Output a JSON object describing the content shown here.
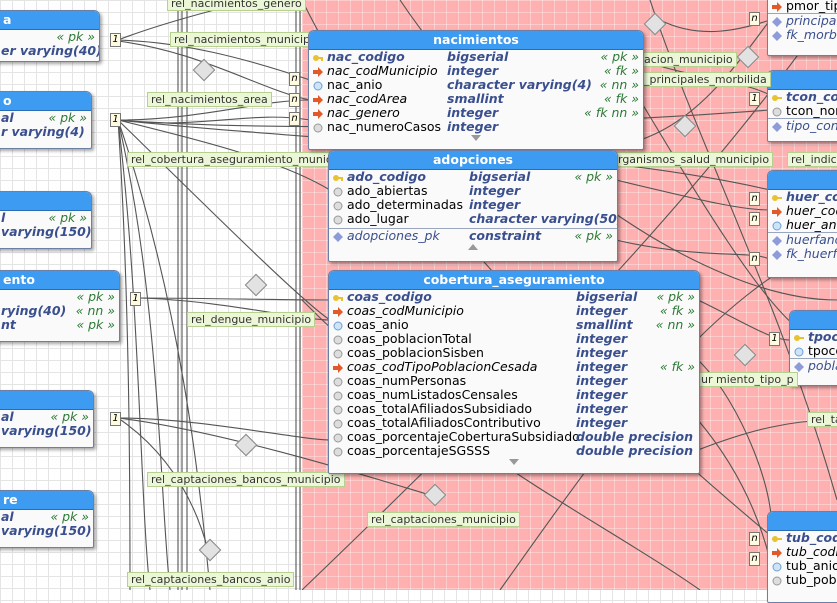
{
  "tables": {
    "nacimientos": {
      "title": "nacimientos",
      "columns": [
        {
          "name": "nac_codigo",
          "type": "bigserial",
          "constraint": "« pk »",
          "kind": "pk"
        },
        {
          "name": "nac_codMunicipio",
          "type": "integer",
          "constraint": "« fk »",
          "kind": "fk"
        },
        {
          "name": "nac_anio",
          "type": "character varying(4)",
          "constraint": "« nn »",
          "kind": "nn"
        },
        {
          "name": "nac_codArea",
          "type": "smallint",
          "constraint": "« fk »",
          "kind": "fk"
        },
        {
          "name": "nac_genero",
          "type": "integer",
          "constraint": "« fk nn »",
          "kind": "fk"
        },
        {
          "name": "nac_numeroCasos",
          "type": "integer",
          "constraint": "",
          "kind": "col"
        }
      ]
    },
    "adopciones": {
      "title": "adopciones",
      "columns": [
        {
          "name": "ado_codigo",
          "type": "bigserial",
          "constraint": "« pk »",
          "kind": "pk"
        },
        {
          "name": "ado_abiertas",
          "type": "integer",
          "constraint": "",
          "kind": "col"
        },
        {
          "name": "ado_determinadas",
          "type": "integer",
          "constraint": "",
          "kind": "col"
        },
        {
          "name": "ado_lugar",
          "type": "character varying(50)",
          "constraint": "",
          "kind": "col"
        }
      ],
      "constraints": [
        {
          "name": "adopciones_pk",
          "type": "constraint",
          "constraint": "« pk »"
        }
      ]
    },
    "cobertura": {
      "title": "cobertura_aseguramiento",
      "columns": [
        {
          "name": "coas_codigo",
          "type": "bigserial",
          "constraint": "« pk »",
          "kind": "pk"
        },
        {
          "name": "coas_codMunicipio",
          "type": "integer",
          "constraint": "« fk »",
          "kind": "fk"
        },
        {
          "name": "coas_anio",
          "type": "smallint",
          "constraint": "« nn »",
          "kind": "nn"
        },
        {
          "name": "coas_poblacionTotal",
          "type": "integer",
          "constraint": "",
          "kind": "col"
        },
        {
          "name": "coas_poblacionSisben",
          "type": "integer",
          "constraint": "",
          "kind": "col"
        },
        {
          "name": "coas_codTipoPoblacionCesada",
          "type": "integer",
          "constraint": "« fk »",
          "kind": "fk"
        },
        {
          "name": "coas_numPersonas",
          "type": "integer",
          "constraint": "",
          "kind": "col"
        },
        {
          "name": "coas_numListadosCensales",
          "type": "integer",
          "constraint": "",
          "kind": "col"
        },
        {
          "name": "coas_totalAfiliadosSubsidiado",
          "type": "integer",
          "constraint": "",
          "kind": "col"
        },
        {
          "name": "coas_totalAfiliadosContributivo",
          "type": "integer",
          "constraint": "",
          "kind": "col"
        },
        {
          "name": "coas_porcentajeCoberturaSubsidiado",
          "type": "double precision",
          "constraint": "",
          "kind": "col"
        },
        {
          "name": "coas_porcentajeSGSSS",
          "type": "double precision",
          "constraint": "",
          "kind": "col"
        }
      ]
    },
    "left1": {
      "title": "a",
      "rows": [
        {
          "name": "",
          "type": "er varying(40)",
          "constraint": "« pk »"
        }
      ]
    },
    "left2": {
      "title": "o",
      "rows": [
        {
          "name": "al",
          "type": "",
          "constraint": "« pk »"
        },
        {
          "name": "",
          "type": "r varying(4)",
          "constraint": ""
        }
      ]
    },
    "left3": {
      "title": "",
      "rows": [
        {
          "name": "l",
          "type": "",
          "constraint": "« pk »"
        },
        {
          "name": "",
          "type": "varying(150)",
          "constraint": ""
        }
      ]
    },
    "left4": {
      "title": "ento",
      "rows": [
        {
          "name": "",
          "type": "",
          "constraint": "« pk »"
        },
        {
          "name": "",
          "type": "rying(40)",
          "constraint": "« nn »"
        },
        {
          "name": "nt",
          "type": "",
          "constraint": "« pk »"
        }
      ]
    },
    "left5": {
      "title": "",
      "rows": [
        {
          "name": "al",
          "type": "",
          "constraint": "« pk »"
        },
        {
          "name": "",
          "type": "varying(150)",
          "constraint": ""
        }
      ]
    },
    "left6": {
      "title": "re",
      "rows": [
        {
          "name": "al",
          "type": "",
          "constraint": "« pk »"
        },
        {
          "name": "",
          "type": "varying(150)",
          "constraint": ""
        }
      ]
    },
    "right1": {
      "rows": [
        "pmor_tip",
        "principal",
        "fk_morbi"
      ]
    },
    "right2": {
      "title": "",
      "rows": [
        "tcon_co",
        "tcon_nor",
        "tipo_con"
      ]
    },
    "right3": {
      "rows": [
        "huer_co",
        "huer_cod",
        "huer_ani",
        "huerfano",
        "fk_huerf"
      ]
    },
    "right4": {
      "rows": [
        "tpoce",
        "tpoce",
        "pobla"
      ]
    },
    "right5": {
      "rows": [
        "tub_cod",
        "tub_codM",
        "tub_anio",
        "tub_pobl"
      ]
    }
  },
  "relations": [
    "rel_nacimientos_genero",
    "rel_nacimientos_municipio",
    "rel_nacimientos_area",
    "rel_cobertura_aseguramiento_munic",
    "rel_dengue_municipio",
    "rel_captaciones_bancos_municipio",
    "rel_captaciones_municipio",
    "rel_captaciones_bancos_anio",
    "acion_municipio",
    "_principales_morbilida",
    "rganismos_salud_municipio",
    "rel_indic",
    "ur miento_tipo_p",
    "rel_ta"
  ],
  "cardinalities": {
    "one": "1",
    "many": "n"
  }
}
